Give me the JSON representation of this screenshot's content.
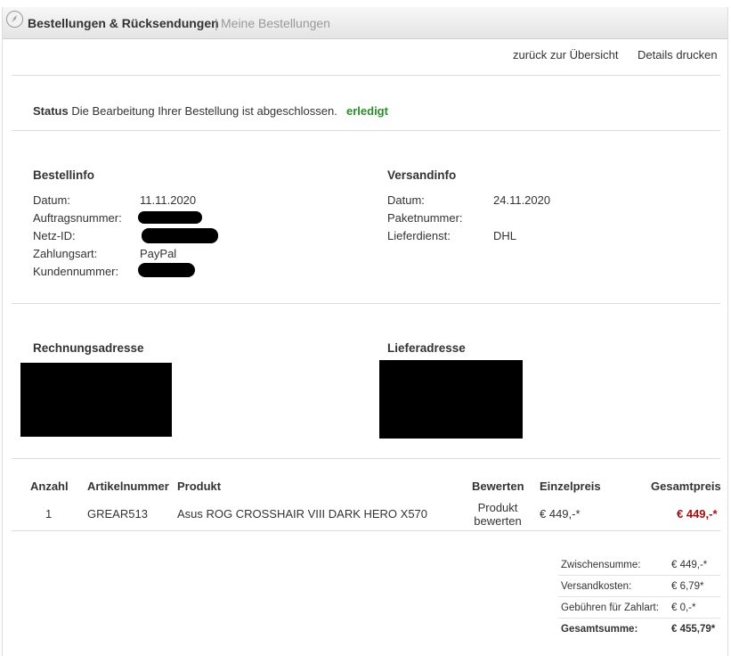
{
  "header": {
    "title": "Bestellungen & Rücksendungen",
    "separator": "|",
    "breadcrumb": "Meine Bestellungen"
  },
  "actions": {
    "back": "zurück zur Übersicht",
    "print": "Details drucken"
  },
  "status": {
    "label": "Status",
    "message": "Die Bearbeitung Ihrer Bestellung ist abgeschlossen.",
    "value": "erledigt",
    "value_color": "#2e8b2e"
  },
  "order_info": {
    "title": "Bestellinfo",
    "date_label": "Datum:",
    "date_value": "11.11.2020",
    "order_no_label": "Auftragsnummer:",
    "net_id_label": "Netz-ID:",
    "payment_label": "Zahlungsart:",
    "payment_value": "PayPal",
    "customer_no_label": "Kundennummer:"
  },
  "shipping_info": {
    "title": "Versandinfo",
    "date_label": "Datum:",
    "date_value": "24.11.2020",
    "parcel_label": "Paketnummer:",
    "carrier_label": "Lieferdienst:",
    "carrier_value": "DHL"
  },
  "addresses": {
    "billing_title": "Rechnungsadresse",
    "delivery_title": "Lieferadresse"
  },
  "items_table": {
    "columns": [
      "Anzahl",
      "Artikelnummer",
      "Produkt",
      "Bewerten",
      "Einzelpreis",
      "Gesamtpreis"
    ],
    "rows": [
      {
        "qty": "1",
        "sku": "GREAR513",
        "product": "Asus ROG CROSSHAIR VIII DARK HERO X570",
        "rate_line1": "Produkt",
        "rate_line2": "bewerten",
        "unit_price": "€ 449,-*",
        "total_price": "€ 449,-*"
      }
    ]
  },
  "totals": {
    "subtotal_label": "Zwischensumme:",
    "subtotal_value": "€ 449,-*",
    "shipping_label": "Versandkosten:",
    "shipping_value": "€ 6,79*",
    "fee_label": "Gebühren für Zahlart:",
    "fee_value": "€ 0,-*",
    "grand_label": "Gesamtsumme:",
    "grand_value": "€ 455,79*",
    "accent_color": "#a01010"
  }
}
